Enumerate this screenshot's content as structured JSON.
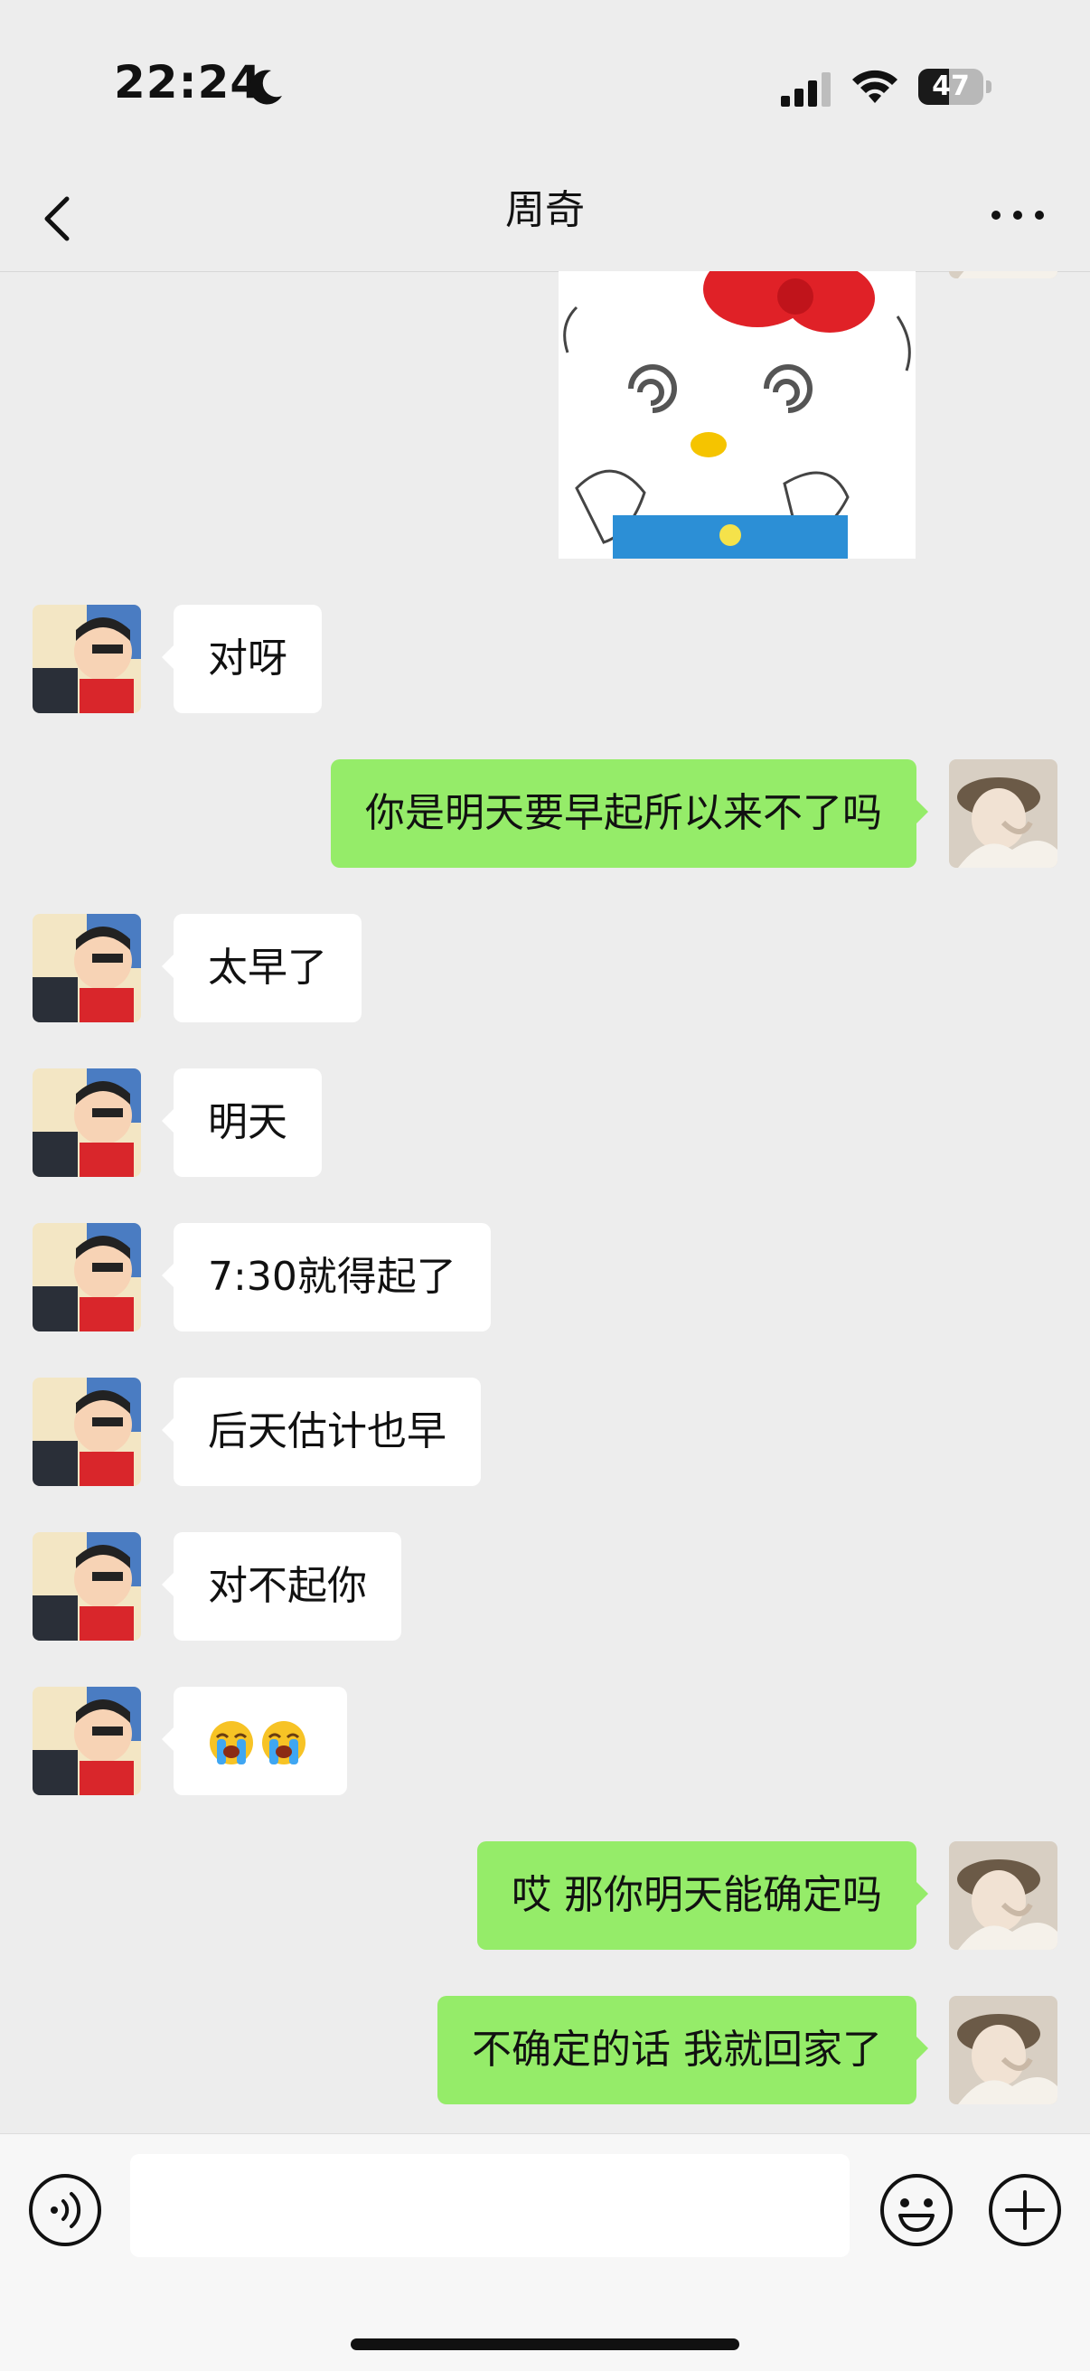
{
  "status_bar": {
    "time": "22:24",
    "battery": "47",
    "battery_level": 0.47
  },
  "header": {
    "title": "周奇",
    "back_icon": "chevron-left-icon",
    "more_icon": "more-dots-icon"
  },
  "messages": [
    {
      "side": "left",
      "text": "对呀"
    },
    {
      "side": "right",
      "text": "你是明天要早起所以来不了吗"
    },
    {
      "side": "left",
      "text": "太早了"
    },
    {
      "side": "left",
      "text": "明天"
    },
    {
      "side": "left",
      "text": "7:30就得起了"
    },
    {
      "side": "left",
      "text": "后天估计也早"
    },
    {
      "side": "left",
      "text": "对不起你"
    },
    {
      "side": "left",
      "text": "",
      "emoji": [
        "loudly-crying-face",
        "loudly-crying-face"
      ]
    },
    {
      "side": "right",
      "text": "哎 那你明天能确定吗"
    },
    {
      "side": "right",
      "text": "不确定的话 我就回家了"
    }
  ],
  "input_bar": {
    "value": "",
    "voice_icon": "voice-icon",
    "emoji_icon": "smiley-icon",
    "plus_icon": "plus-icon"
  },
  "colors": {
    "background": "#ededed",
    "my_bubble": "#95ec69",
    "their_bubble": "#ffffff"
  }
}
